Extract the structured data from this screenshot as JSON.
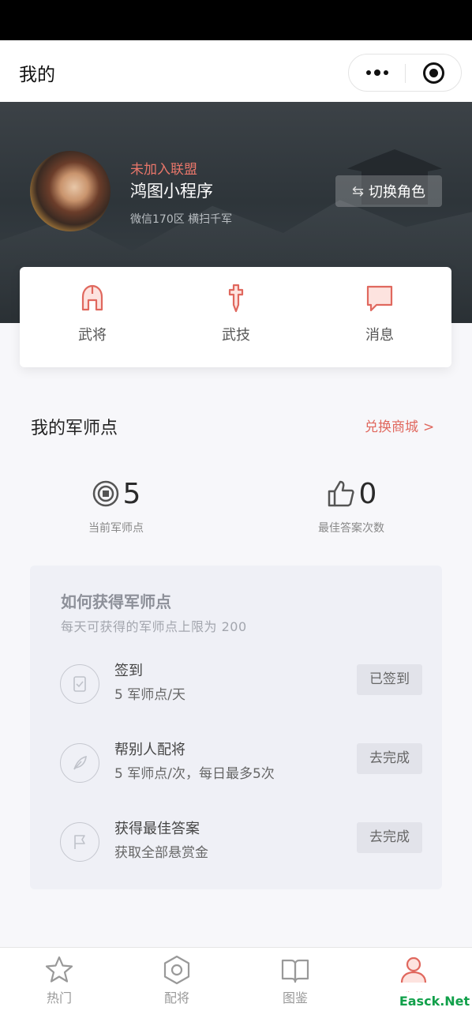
{
  "nav": {
    "title": "我的"
  },
  "profile": {
    "alliance": "未加入联盟",
    "name": "鸿图小程序",
    "server": "微信170区 横扫千军",
    "switch_label": "切换角色"
  },
  "quick_actions": [
    {
      "label": "武将",
      "icon": "helmet-icon"
    },
    {
      "label": "武技",
      "icon": "sword-icon"
    },
    {
      "label": "消息",
      "icon": "message-icon"
    }
  ],
  "points": {
    "title": "我的军师点",
    "shop_label": "兑换商城",
    "current_value": "5",
    "current_label": "当前军师点",
    "best_value": "0",
    "best_label": "最佳答案次数"
  },
  "earn": {
    "title": "如何获得军师点",
    "subtitle": "每天可获得的军师点上限为 200",
    "tasks": [
      {
        "name": "签到",
        "desc": "5 军师点/天",
        "button": "已签到",
        "icon": "checkin-icon"
      },
      {
        "name": "帮别人配将",
        "desc": "5 军师点/次，每日最多5次",
        "button": "去完成",
        "icon": "feather-icon"
      },
      {
        "name": "获得最佳答案",
        "desc": "获取全部悬赏金",
        "button": "去完成",
        "icon": "flag-icon"
      }
    ]
  },
  "tabbar": {
    "items": [
      {
        "label": "热门",
        "icon": "star-icon"
      },
      {
        "label": "配将",
        "icon": "hexagon-icon"
      },
      {
        "label": "图鉴",
        "icon": "book-icon"
      },
      {
        "label": "我的",
        "icon": "user-icon",
        "active": true
      }
    ]
  },
  "watermark": "Easck.Net",
  "colors": {
    "accent": "#e0685e",
    "panel": "#eff0f6"
  }
}
